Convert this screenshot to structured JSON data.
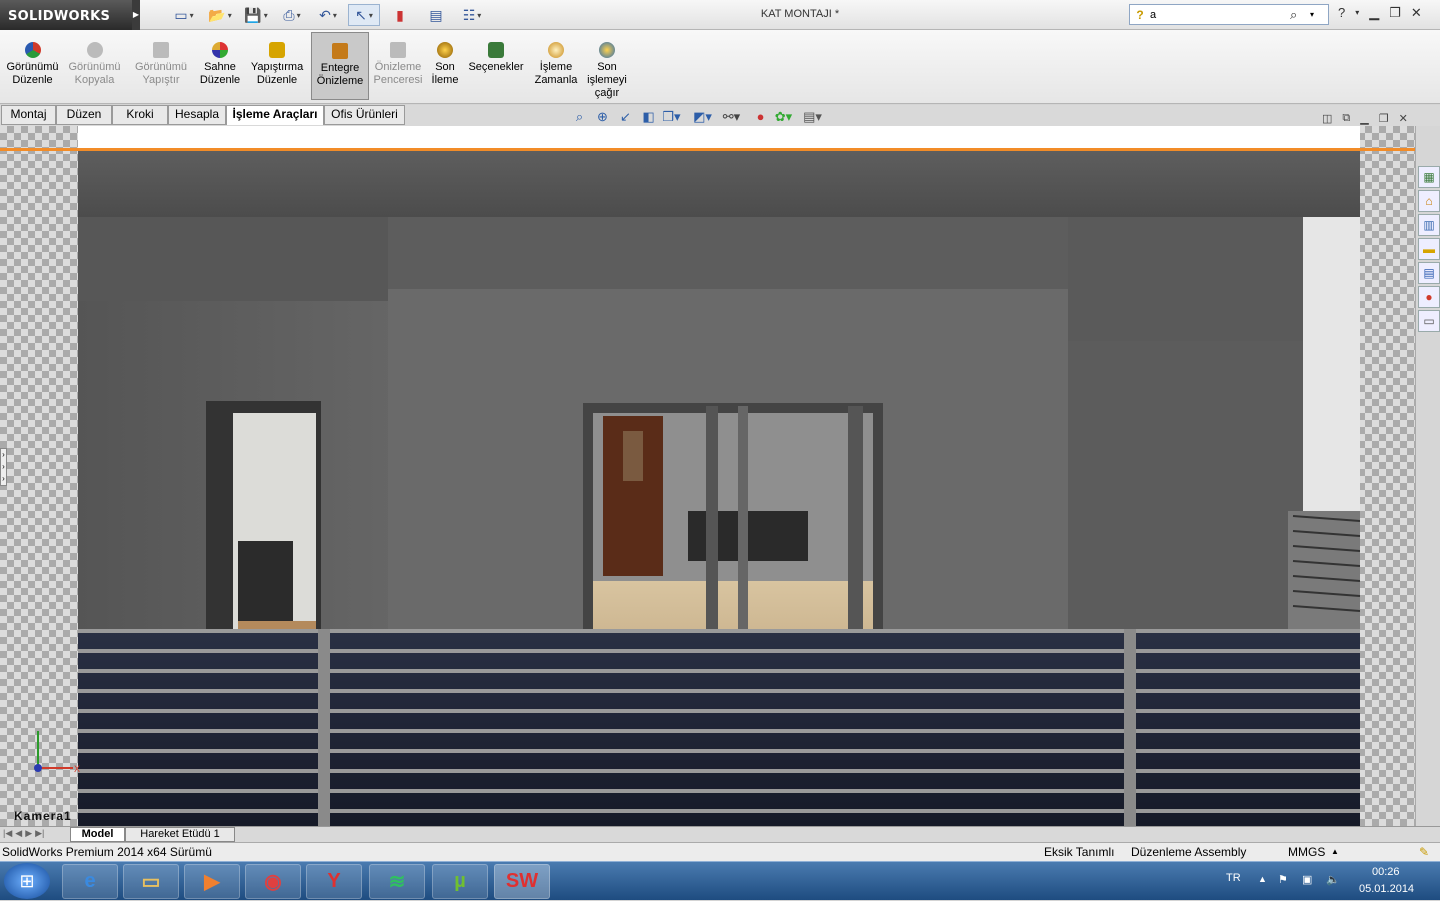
{
  "app": {
    "brand": "SOLIDWORKS",
    "document_title": "KAT MONTAJI *"
  },
  "search": {
    "value": "a"
  },
  "quick_access": [
    "new-document-icon",
    "open-icon",
    "save-icon",
    "print-icon",
    "undo-icon",
    "select-icon",
    "rebuild-icon",
    "file-properties-icon",
    "options-icon"
  ],
  "ribbon": {
    "buttons": [
      {
        "label": "Görünümü\nDüzenle",
        "icon": "appearance-icon",
        "color": "#d03a2a",
        "enabled": true
      },
      {
        "label": "Görünümü\nKopyala",
        "icon": "copy-appearance-icon",
        "color": "#aaaaaa",
        "enabled": false
      },
      {
        "label": "Görünümü\nYapıştır",
        "icon": "paste-appearance-icon",
        "color": "#aaaaaa",
        "enabled": false
      },
      {
        "label": "Sahne\nDüzenle",
        "icon": "scene-icon",
        "color": "#3a9a3a",
        "enabled": true
      },
      {
        "label": "Yapıştırma\nDüzenle",
        "icon": "decal-icon",
        "color": "#d6a400",
        "enabled": true
      },
      {
        "label": "Entegre\nÖnizleme",
        "icon": "integrated-preview-icon",
        "color": "#c47a1a",
        "enabled": true,
        "active": true
      },
      {
        "label": "Önizleme\nPenceresi",
        "icon": "preview-window-icon",
        "color": "#aaaaaa",
        "enabled": false
      },
      {
        "label": "Son\nİleme",
        "icon": "final-render-icon",
        "color": "#d08a00",
        "enabled": true
      },
      {
        "label": "Seçenekler",
        "icon": "options-render-icon",
        "color": "#3a7a3a",
        "enabled": true
      },
      {
        "label": "İşleme\nZamanla",
        "icon": "schedule-render-icon",
        "color": "#c88a1a",
        "enabled": true
      },
      {
        "label": "Son\nişlemeyi\nçağır",
        "icon": "recall-render-icon",
        "color": "#2a6ab0",
        "enabled": true
      }
    ]
  },
  "tabs": [
    "Montaj",
    "Düzen",
    "Kroki",
    "Hesapla",
    "İşleme Araçları",
    "Ofis Ürünleri"
  ],
  "active_tab": "İşleme Araçları",
  "view_toolbar": [
    "zoom-to-fit-icon",
    "zoom-area-icon",
    "previous-view-icon",
    "section-view-icon",
    "view-orientation-icon",
    "display-style-icon",
    "hide-show-icon",
    "edit-appearance-icon",
    "apply-scene-icon",
    "view-settings-icon"
  ],
  "viewport": {
    "camera_label": "Kamera1"
  },
  "taskpane": [
    "solidworks-resources-icon",
    "home-icon",
    "design-library-icon",
    "file-explorer-icon",
    "view-palette-icon",
    "appearances-icon",
    "custom-properties-icon"
  ],
  "model_tabs": [
    "Model",
    "Hareket Etüdü 1"
  ],
  "status": {
    "version": "SolidWorks Premium 2014 x64 Sürümü",
    "definition": "Eksik Tanımlı",
    "mode": "Düzenleme Assembly",
    "units": "MMGS"
  },
  "taskbar": {
    "apps": [
      "internet-explorer-icon",
      "file-explorer-icon",
      "media-player-icon",
      "chrome-icon",
      "yandex-icon",
      "spotify-icon",
      "utorrent-icon",
      "solidworks-icon"
    ],
    "language": "TR",
    "time": "00:26",
    "date": "05.01.2014"
  }
}
